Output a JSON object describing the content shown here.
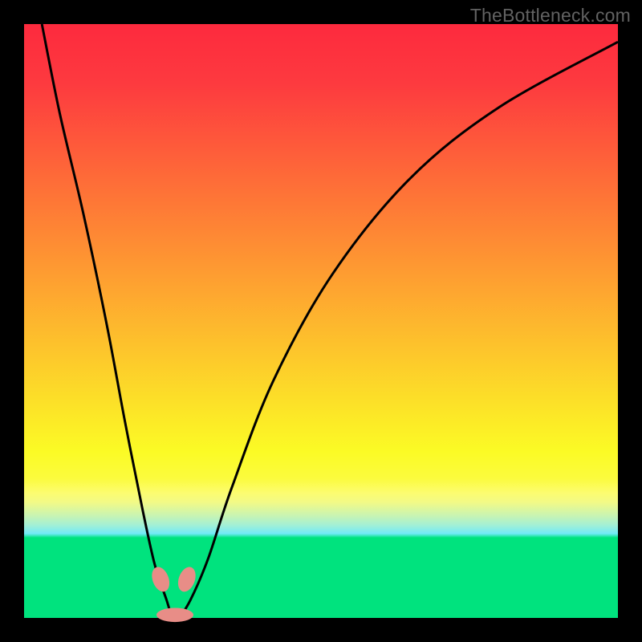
{
  "watermark": "TheBottleneck.com",
  "chart_data": {
    "type": "line",
    "title": "",
    "xlabel": "",
    "ylabel": "",
    "xlim": [
      0,
      100
    ],
    "ylim": [
      0,
      100
    ],
    "series": [
      {
        "name": "bottleneck-curve",
        "x": [
          3,
          6,
          10,
          14,
          17,
          20,
          22,
          24,
          25,
          26,
          28,
          31,
          35,
          42,
          52,
          65,
          80,
          100
        ],
        "y": [
          100,
          85,
          68,
          49,
          33,
          18,
          9,
          3,
          0,
          0,
          3,
          10,
          22,
          40,
          58,
          74,
          86,
          97
        ]
      }
    ],
    "annotations": [
      {
        "name": "marker-left",
        "x": 23.0,
        "y": 6.5
      },
      {
        "name": "marker-right",
        "x": 27.4,
        "y": 6.5
      },
      {
        "name": "marker-bottom",
        "x": 25.4,
        "y": 0.5
      }
    ],
    "style": {
      "curve_color": "#000000",
      "curve_width": 3,
      "marker_color": "#e88d87",
      "marker_rx": 10,
      "marker_ry": 16,
      "gradient_stops": [
        {
          "pos": 0.0,
          "color": "#fd2a3e"
        },
        {
          "pos": 0.4,
          "color": "#fe9632"
        },
        {
          "pos": 0.7,
          "color": "#fcee26"
        },
        {
          "pos": 0.87,
          "color": "#00e37e"
        }
      ]
    }
  }
}
